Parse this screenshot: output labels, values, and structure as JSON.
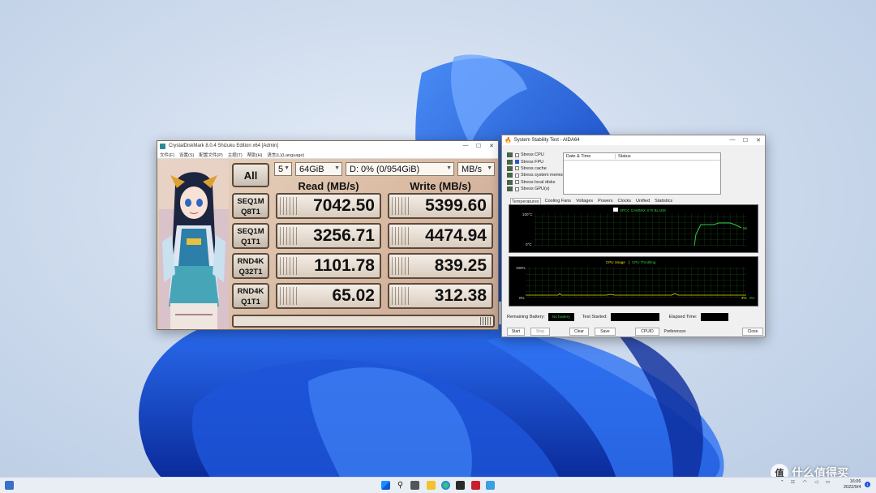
{
  "cdm": {
    "title": "CrystalDiskMark 8.0.4 Shizuku Edition x64 [Admin]",
    "menu": [
      "文件(F)",
      "设置(S)",
      "配置文件(P)",
      "主题(T)",
      "帮助(H)",
      "语言(L)(Language)"
    ],
    "all_button": "All",
    "runs": "5",
    "size": "64GiB",
    "drive": "D: 0% (0/954GiB)",
    "unit": "MB/s",
    "read_header": "Read (MB/s)",
    "write_header": "Write (MB/s)",
    "rows": [
      {
        "l1": "SEQ1M",
        "l2": "Q8T1",
        "read": "7042.50",
        "write": "5399.60"
      },
      {
        "l1": "SEQ1M",
        "l2": "Q1T1",
        "read": "3256.71",
        "write": "4474.94"
      },
      {
        "l1": "RND4K",
        "l2": "Q32T1",
        "read": "1101.78",
        "write": "839.25"
      },
      {
        "l1": "RND4K",
        "l2": "Q1T1",
        "read": "65.02",
        "write": "312.38"
      }
    ]
  },
  "aida": {
    "title": "System Stability Test - AIDA64",
    "stress": [
      {
        "label": "Stress CPU",
        "checked": false
      },
      {
        "label": "Stress FPU",
        "checked": true
      },
      {
        "label": "Stress cache",
        "checked": false
      },
      {
        "label": "Stress system memory",
        "checked": false
      },
      {
        "label": "Stress local disks",
        "checked": false
      },
      {
        "label": "Stress GPU(s)",
        "checked": false
      }
    ],
    "log_headers": [
      "Date & Time",
      "Status"
    ],
    "tabs": [
      "Temperatures",
      "Cooling Fans",
      "Voltages",
      "Powers",
      "Clocks",
      "Unified",
      "Statistics"
    ],
    "temp_graph": {
      "legend": "SPCC GAMMIX S70 BLADE",
      "top": "100°C",
      "bottom": "0°C",
      "current": "56"
    },
    "usage_graph": {
      "legend1": "CPU Usage",
      "sep": "|",
      "legend2": "CPU Throttling",
      "top": "100%",
      "bottom": "0%",
      "current": "4%",
      "current2": "0%"
    },
    "remaining_battery_label": "Remaining Battery:",
    "battery_value": "No battery",
    "test_started_label": "Test Started:",
    "elapsed_label": "Elapsed Time:",
    "buttons": {
      "start": "Start",
      "stop": "Stop",
      "clear": "Clear",
      "save": "Save",
      "cpuid": "CPUID",
      "prefs": "Preferences",
      "close": "Close"
    }
  },
  "taskbar": {
    "tray_time": "16:06",
    "tray_date": "2022/9/4",
    "notif": "1"
  },
  "watermark": {
    "logo": "值",
    "text": "什么值得买"
  },
  "colors": {
    "accent": "#1a52d8",
    "cdm_border": "#5a4a3d",
    "graph_green": "#2ecc40"
  }
}
